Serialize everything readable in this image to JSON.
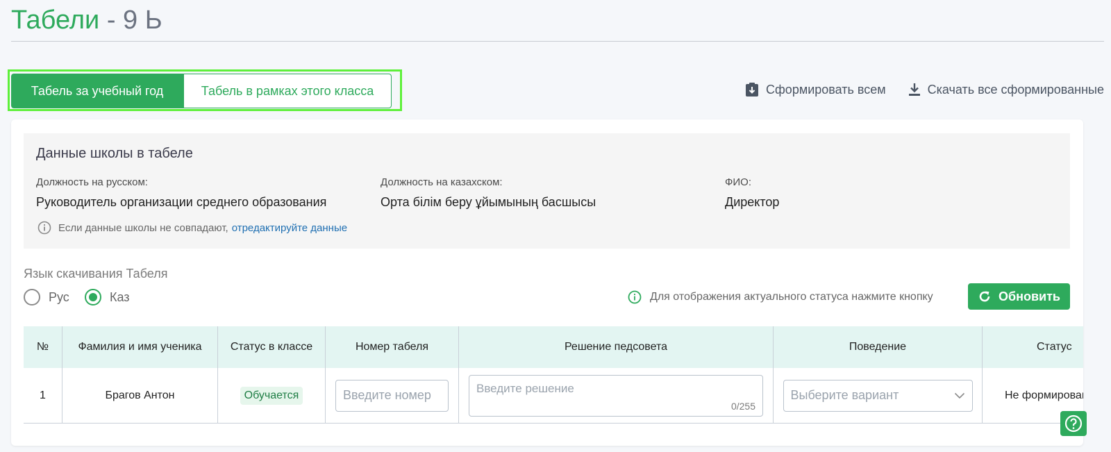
{
  "header": {
    "title": "Табели",
    "separator": "-",
    "class_name": "9 Ь"
  },
  "tabs": [
    {
      "label": "Табель за учебный год",
      "active": true
    },
    {
      "label": "Табель в рамках этого класса",
      "active": false
    }
  ],
  "actions": {
    "generate_all": "Сформировать всем",
    "download_all": "Скачать все сформированные"
  },
  "school": {
    "title": "Данные школы в табеле",
    "position_ru_label": "Должность на русском:",
    "position_ru_value": "Руководитель организации среднего образования",
    "position_kz_label": "Должность на казахском:",
    "position_kz_value": "Орта білім беру ұйымының басшысы",
    "fio_label": "ФИО:",
    "fio_value": "Директор",
    "note_text": "Если данные школы не совпадают,",
    "note_link": "отредактируйте данные"
  },
  "language": {
    "title": "Язык скачивания Табеля",
    "options": [
      {
        "label": "Рус",
        "checked": false
      },
      {
        "label": "Каз",
        "checked": true
      }
    ]
  },
  "status_note": "Для отображения актуального статуса нажмите кнопку",
  "refresh_label": "Обновить",
  "table": {
    "columns": [
      "№",
      "Фамилия и имя ученика",
      "Статус в классе",
      "Номер табеля",
      "Решение педсовета",
      "Поведение",
      "Статус"
    ],
    "rows": [
      {
        "num": "1",
        "name": "Брагов Антон",
        "status": "Обучается",
        "number_placeholder": "Введите номер",
        "decision_placeholder": "Введите решение",
        "decision_counter": "0/255",
        "behavior_placeholder": "Выберите вариант",
        "doc_status": "Не формирован"
      }
    ]
  },
  "colors": {
    "accent": "#2eaa5c",
    "highlight": "#5ef03a",
    "link": "#1f6fb2",
    "table_header": "#e3f5f2"
  },
  "icons": {
    "generate": "clipboard-download-icon",
    "download": "download-icon",
    "info": "info-icon",
    "refresh": "refresh-icon",
    "chevron": "chevron-down-icon",
    "help": "help-icon"
  }
}
